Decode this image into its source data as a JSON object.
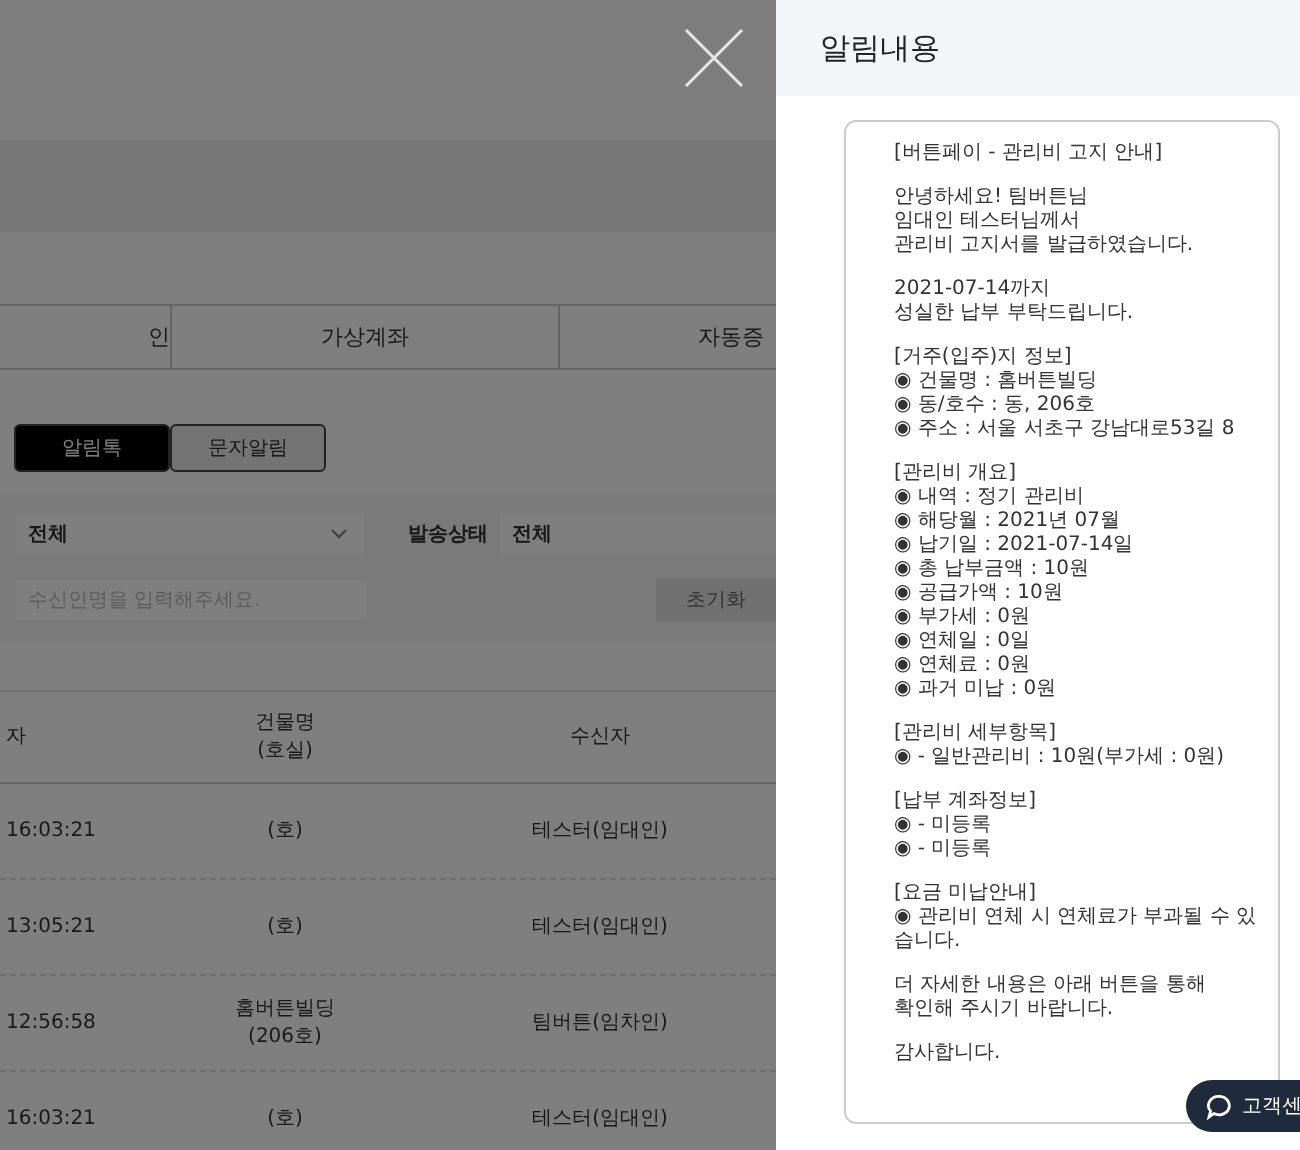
{
  "background_page": {
    "tabs": [
      {
        "label": "인",
        "selected": false
      },
      {
        "label": "가상계좌",
        "selected": false
      },
      {
        "label": "자동증",
        "selected": false
      }
    ],
    "toggle": [
      {
        "label": "알림톡",
        "selected": true
      },
      {
        "label": "문자알림",
        "selected": false
      }
    ],
    "filters": {
      "type_select": "전체",
      "status_label": "발송상태",
      "status_select": "전체",
      "search": {
        "placeholder": "수신인명을 입력해주세요."
      },
      "reset_button": "초기화"
    },
    "table": {
      "columns": [
        "자",
        "건물명\n(호실)",
        "수신자"
      ],
      "rows": [
        [
          "16:03:21",
          "(호)",
          "테스터(임대인)"
        ],
        [
          "13:05:21",
          "(호)",
          "테스터(임대인)"
        ],
        [
          "12:56:58",
          "홈버튼빌딩\n(206호)",
          "팀버튼(임차인)"
        ],
        [
          "16:03:21",
          "(호)",
          "테스터(임대인)"
        ]
      ]
    }
  },
  "drawer": {
    "title": "알림내용",
    "message": [
      [
        "[버튼페이 - 관리비 고지 안내]"
      ],
      [
        "안녕하세요! 팀버튼님",
        "임대인 테스터님께서",
        "관리비 고지서를 발급하였습니다."
      ],
      [
        "2021-07-14까지",
        "성실한 납부 부탁드립니다."
      ],
      [
        "[거주(입주)지 정보]",
        "◉ 건물명 : 홈버튼빌딩",
        "◉ 동/호수 : 동, 206호",
        "◉ 주소 : 서울 서초구 강남대로53길 8"
      ],
      [
        "[관리비 개요]",
        "◉ 내역 : 정기 관리비",
        "◉ 해당월 : 2021년 07월",
        "◉ 납기일 : 2021-07-14일",
        "◉ 총 납부금액 : 10원",
        "◉ 공급가액 : 10원",
        "◉ 부가세 : 0원",
        "◉ 연체일 : 0일",
        "◉ 연체료 : 0원",
        "◉ 과거 미납 : 0원"
      ],
      [
        "[관리비 세부항목]",
        "◉ - 일반관리비 : 10원(부가세 : 0원)"
      ],
      [
        "[납부 계좌정보]",
        "◉ - 미등록",
        "◉ - 미등록"
      ],
      [
        "[요금 미납안내]",
        "◉ 관리비 연체 시 연체료가 부과될 수 있습니다."
      ],
      [
        "더 자세한 내용은 아래 버튼을 통해",
        "확인해 주시기 바랍니다."
      ],
      [
        "감사합니다."
      ]
    ]
  },
  "chat_button": "고객센"
}
